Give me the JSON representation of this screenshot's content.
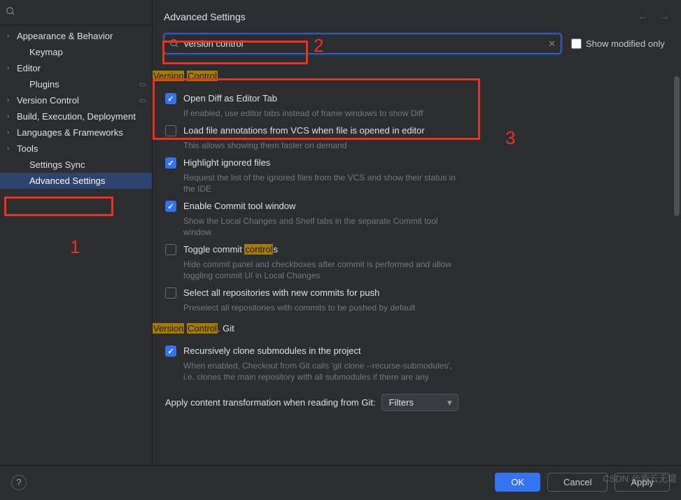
{
  "sidebar": {
    "search_placeholder": "",
    "items": [
      {
        "label": "Appearance & Behavior",
        "expandable": true,
        "child": false
      },
      {
        "label": "Keymap",
        "expandable": false,
        "child": true
      },
      {
        "label": "Editor",
        "expandable": true,
        "child": false
      },
      {
        "label": "Plugins",
        "expandable": false,
        "child": true,
        "cog": true
      },
      {
        "label": "Version Control",
        "expandable": true,
        "child": false,
        "cog": true
      },
      {
        "label": "Build, Execution, Deployment",
        "expandable": true,
        "child": false
      },
      {
        "label": "Languages & Frameworks",
        "expandable": true,
        "child": false
      },
      {
        "label": "Tools",
        "expandable": true,
        "child": false
      },
      {
        "label": "Settings Sync",
        "expandable": false,
        "child": true
      },
      {
        "label": "Advanced Settings",
        "expandable": false,
        "child": true,
        "selected": true
      }
    ]
  },
  "header": {
    "title": "Advanced Settings"
  },
  "search": {
    "value": "version control",
    "modified_only_label": "Show modified only"
  },
  "sections": [
    {
      "title_parts": [
        "Version",
        " ",
        "Control"
      ],
      "highlight_idx": [
        0,
        2
      ],
      "settings": [
        {
          "checked": true,
          "label_parts": [
            "Open Diff as Editor Tab"
          ],
          "desc": "If enabled, use editor tabs instead of frame windows to show Diff"
        },
        {
          "checked": false,
          "label_parts": [
            "Load file annotations from VCS when file is opened in editor"
          ],
          "desc": "This allows showing them faster on demand"
        },
        {
          "checked": true,
          "label_parts": [
            "Highlight ignored files"
          ],
          "desc": "Request the list of the ignored files from the VCS and show their status in the IDE"
        },
        {
          "checked": true,
          "label_parts": [
            "Enable Commit tool window"
          ],
          "desc": "Show the Local Changes and Shelf tabs in the separate Commit tool window"
        },
        {
          "checked": false,
          "label_parts": [
            "Toggle commit ",
            "control",
            "s"
          ],
          "hl_idx": [
            1
          ],
          "desc": "Hide commit panel and checkboxes after commit is performed and allow toggling commit UI in Local Changes"
        },
        {
          "checked": false,
          "label_parts": [
            "Select all repositories with new commits for push"
          ],
          "desc": "Preselect all repositories with commits to be pushed by default"
        }
      ]
    },
    {
      "title_parts": [
        "Version",
        " ",
        "Control",
        ". Git"
      ],
      "highlight_idx": [
        0,
        2
      ],
      "settings": [
        {
          "checked": true,
          "label_parts": [
            "Recursively clone submodules in the project"
          ],
          "desc": "When enabled, Checkout from Git calls 'git clone --recurse-submodules', i.e. clones the main repository with all submodules if there are any"
        }
      ],
      "dropdown_row": {
        "label": "Apply content transformation when reading from Git:",
        "value": "Filters"
      }
    }
  ],
  "footer": {
    "ok": "OK",
    "cancel": "Cancel",
    "apply": "Apply"
  },
  "annotations": {
    "n1": "1",
    "n2": "2",
    "n3": "3"
  },
  "watermark": "CSDN @紫云无堤"
}
